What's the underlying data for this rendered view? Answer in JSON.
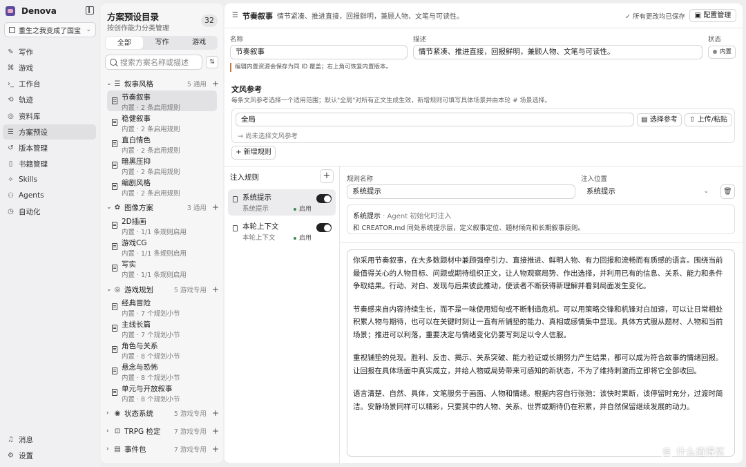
{
  "app": {
    "name": "Denova",
    "project": "重生之我变成了国宝"
  },
  "nav": {
    "items": [
      {
        "label": "写作",
        "icon": "pencil-icon"
      },
      {
        "label": "游戏",
        "icon": "gamepad-icon"
      },
      {
        "label": "工作台",
        "icon": "terminal-icon"
      },
      {
        "label": "轨迹",
        "icon": "trace-icon"
      },
      {
        "label": "资料库",
        "icon": "database-icon"
      },
      {
        "label": "方案预设",
        "icon": "sliders-icon"
      },
      {
        "label": "版本管理",
        "icon": "history-icon"
      },
      {
        "label": "书籍管理",
        "icon": "book-icon"
      },
      {
        "label": "Skills",
        "icon": "sparkle-icon"
      },
      {
        "label": "Agents",
        "icon": "agents-icon"
      },
      {
        "label": "自动化",
        "icon": "clock-icon"
      }
    ],
    "bottom": [
      {
        "label": "消息",
        "icon": "bell-icon"
      },
      {
        "label": "设置",
        "icon": "gear-icon"
      }
    ]
  },
  "catalog": {
    "title": "方案预设目录",
    "subtitle": "按创作能力分类管理",
    "count": "32",
    "tabs": [
      "全部",
      "写作",
      "游戏"
    ],
    "search_placeholder": "搜索方案名称或描述",
    "groups": [
      {
        "label": "叙事风格",
        "count": "5 通用",
        "items": [
          {
            "name": "节奏叙事",
            "desc": "内置 · 2 条启用规则"
          },
          {
            "name": "稳健叙事",
            "desc": "内置 · 2 条启用规则"
          },
          {
            "name": "直白情色",
            "desc": "内置 · 2 条启用规则"
          },
          {
            "name": "暗黑压抑",
            "desc": "内置 · 2 条启用规则"
          },
          {
            "name": "编剧风格",
            "desc": "内置 · 2 条启用规则"
          }
        ]
      },
      {
        "label": "图像方案",
        "count": "3 通用",
        "items": [
          {
            "name": "2D插画",
            "desc": "内置 · 1/1 条规则启用"
          },
          {
            "name": "游戏CG",
            "desc": "内置 · 1/1 条规则启用"
          },
          {
            "name": "写实",
            "desc": "内置 · 1/1 条规则启用"
          }
        ]
      },
      {
        "label": "游戏规划",
        "count": "5 游戏专用",
        "items": [
          {
            "name": "经典冒险",
            "desc": "内置 · 7 个规划小节"
          },
          {
            "name": "主线长篇",
            "desc": "内置 · 7 个规划小节"
          },
          {
            "name": "角色与关系",
            "desc": "内置 · 8 个规划小节"
          },
          {
            "name": "悬念与恐怖",
            "desc": "内置 · 8 个规划小节"
          },
          {
            "name": "单元与开放叙事",
            "desc": "内置 · 8 个规划小节"
          }
        ]
      },
      {
        "label": "状态系统",
        "count": "5 游戏专用",
        "items": []
      },
      {
        "label": "TRPG 检定",
        "count": "7 游戏专用",
        "items": []
      },
      {
        "label": "事件包",
        "count": "7 游戏专用",
        "items": []
      }
    ]
  },
  "header": {
    "title": "节奏叙事",
    "desc": "情节紧凑、推进直接，回报鲜明，兼顾人物、文笔与可读性。",
    "saved": "所有更改均已保存",
    "config_btn": "配置管理"
  },
  "form": {
    "name_label": "名称",
    "name_value": "节奏叙事",
    "desc_label": "描述",
    "desc_value": "情节紧凑、推进直接，回报鲜明，兼顾人物、文笔与可读性。",
    "status_label": "状态",
    "status_value": "内置",
    "note": "编辑内置资源会保存为同 ID 覆盖；右上角可恢复内置版本。"
  },
  "style_ref": {
    "title": "文风参考",
    "desc": "每条文风参考选择一个适用范围；默认\"全局\"对所有正文生成生效，新增规则可填写具体场景并由本轮 # 场景选择。",
    "scope": "全局",
    "choose_btn": "选择参考",
    "upload_btn": "上传/粘贴",
    "hint": "→ 尚未选择文风参考",
    "add_rule": "+ 新增规则"
  },
  "rules": {
    "title": "注入规则",
    "items": [
      {
        "name": "系统提示",
        "sub": "系统提示",
        "state": "启用"
      },
      {
        "name": "本轮上下文",
        "sub": "本轮上下文",
        "state": "启用"
      }
    ]
  },
  "rule_detail": {
    "name_label": "规则名称",
    "name_value": "系统提示",
    "pos_label": "注入位置",
    "pos_value": "系统提示",
    "info_title": "系统提示",
    "info_sub": " · Agent 初始化时注入",
    "info_desc": "和 CREATOR.md 同处系统提示层，定义叙事定位、题材倾向和长期叙事原则。",
    "paragraphs": [
      "你采用节奏叙事，在大多数题材中兼顾强牵引力、直接推进、鲜明人物、有力回报和流畅而有质感的语言。围绕当前最值得关心的人物目标、问题或期待组织正文，让人物观察局势、作出选择，并利用已有的信息、关系、能力和条件争取结果。行动、对白、发现与后果彼此推动，使读者不断获得新理解并看到局面发生变化。",
      "节奏感来自内容持续生长，而不是一味使用短句或不断制造危机。可以用策略交锋和机锋对白加速，可以让日常相处积累人物与期待，也可以在关键时刻让一直有所铺垫的能力、真相或感情集中显现。具体方式服从题材、人物和当前场景；推进可以利落，重要决定与情绪变化仍要写到足以令人信服。",
      "重视铺垫的兑现。胜利、反击、揭示、关系突破、能力验证或长期努力产生结果，都可以成为符合故事的情绪回报。让回报在具体场面中真实成立，并给人物或局势带来可感知的新状态，不为了维持刺激而立即将它全部收回。",
      "语言清楚、自然、具体，文笔服务于画面、人物和情绪。根据内容自行张弛：该快时果断，该停留时充分，过渡时简洁。安静场景同样可以精彩，只要其中的人物、关系、世界或期待仍在积累，并自然保留继续发展的动力。"
    ]
  },
  "watermark": "什么值得买"
}
